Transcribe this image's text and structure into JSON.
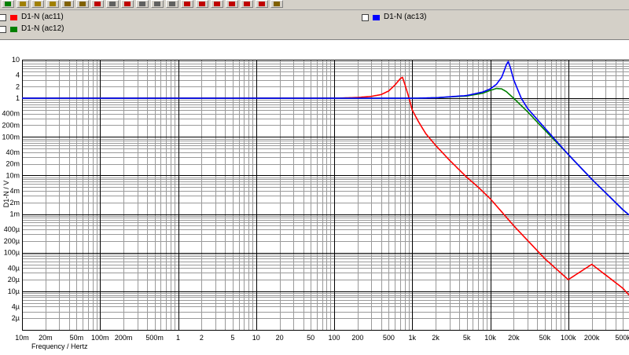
{
  "toolbar": {
    "buttons": [
      "undo-icon",
      "zoom-in-icon",
      "zoom-out-icon",
      "zoom-fit-icon",
      "pointer-icon",
      "cursor-icon",
      "abc-icon",
      "measure-icon",
      "marker-icon",
      "grid-icon",
      "list-icon",
      "chart-icon",
      "pen-icon",
      "curve-icon",
      "curve-icon",
      "curve-icon",
      "curve-icon",
      "curve-icon",
      "settings-icon"
    ]
  },
  "legend": [
    {
      "label": "D1-N (ac11)",
      "color": "#ff0000",
      "checked": false
    },
    {
      "label": "D1-N (ac12)",
      "color": "#008000",
      "checked": false
    },
    {
      "label": "D1-N (ac13)",
      "color": "#0000ff",
      "checked": false
    }
  ],
  "colors": {
    "grid_major": "#000000",
    "grid_minor": "#9a9a9a",
    "background": "#ffffff"
  },
  "chart_data": {
    "type": "line",
    "xlabel": "Frequency / Hertz",
    "ylabel": "D1-N / V",
    "xscale": "log",
    "yscale": "log",
    "xlim": [
      0.01,
      600000
    ],
    "ylim": [
      1e-06,
      10
    ],
    "grid": true,
    "legend_position": "top",
    "x_ticks": [
      "10m",
      "20m",
      "50m",
      "100m",
      "200m",
      "500m",
      "1",
      "2",
      "5",
      "10",
      "20",
      "50",
      "100",
      "200",
      "500",
      "1k",
      "2k",
      "5k",
      "10k",
      "20k",
      "50k",
      "100k",
      "200k",
      "500k"
    ],
    "y_ticks": [
      "10",
      "4",
      "2",
      "1",
      "400m",
      "200m",
      "100m",
      "40m",
      "20m",
      "10m",
      "4m",
      "2m",
      "1m",
      "400µ",
      "200µ",
      "100µ",
      "40µ",
      "20µ",
      "10µ",
      "4µ",
      "2µ"
    ],
    "series": [
      {
        "name": "D1-N (ac11)",
        "color": "#ff0000",
        "x": [
          0.01,
          100,
          200,
          300,
          400,
          500,
          600,
          700,
          750,
          800,
          900,
          1000,
          1200,
          1500,
          2000,
          3000,
          5000,
          7000,
          10000,
          20000,
          50000,
          100000,
          200000,
          500000,
          600000
        ],
        "y": [
          1,
          1,
          1.05,
          1.12,
          1.25,
          1.55,
          2.2,
          3.2,
          3.5,
          2.4,
          1.1,
          0.5,
          0.25,
          0.12,
          0.06,
          0.025,
          0.009,
          0.005,
          0.0025,
          0.0005,
          7e-05,
          2e-05,
          5e-05,
          1.2e-05,
          8e-06
        ]
      },
      {
        "name": "D1-N (ac12)",
        "color": "#008000",
        "x": [
          0.01,
          1000,
          2000,
          5000,
          8000,
          10000,
          12000,
          14000,
          16000,
          20000,
          30000,
          50000,
          100000,
          200000,
          500000,
          600000
        ],
        "y": [
          1,
          1,
          1.03,
          1.15,
          1.35,
          1.6,
          1.8,
          1.75,
          1.5,
          1.0,
          0.45,
          0.15,
          0.035,
          0.008,
          0.0013,
          0.00095
        ]
      },
      {
        "name": "D1-N (ac13)",
        "color": "#0000ff",
        "x": [
          0.01,
          1000,
          2000,
          5000,
          8000,
          10000,
          12000,
          14000,
          15000,
          16000,
          17000,
          18000,
          20000,
          25000,
          30000,
          50000,
          100000,
          200000,
          500000,
          600000
        ],
        "y": [
          1,
          1,
          1.03,
          1.18,
          1.45,
          1.75,
          2.3,
          3.5,
          5.0,
          7.2,
          9.0,
          6.5,
          3.0,
          1.0,
          0.55,
          0.17,
          0.035,
          0.008,
          0.0013,
          0.00095
        ]
      }
    ]
  }
}
